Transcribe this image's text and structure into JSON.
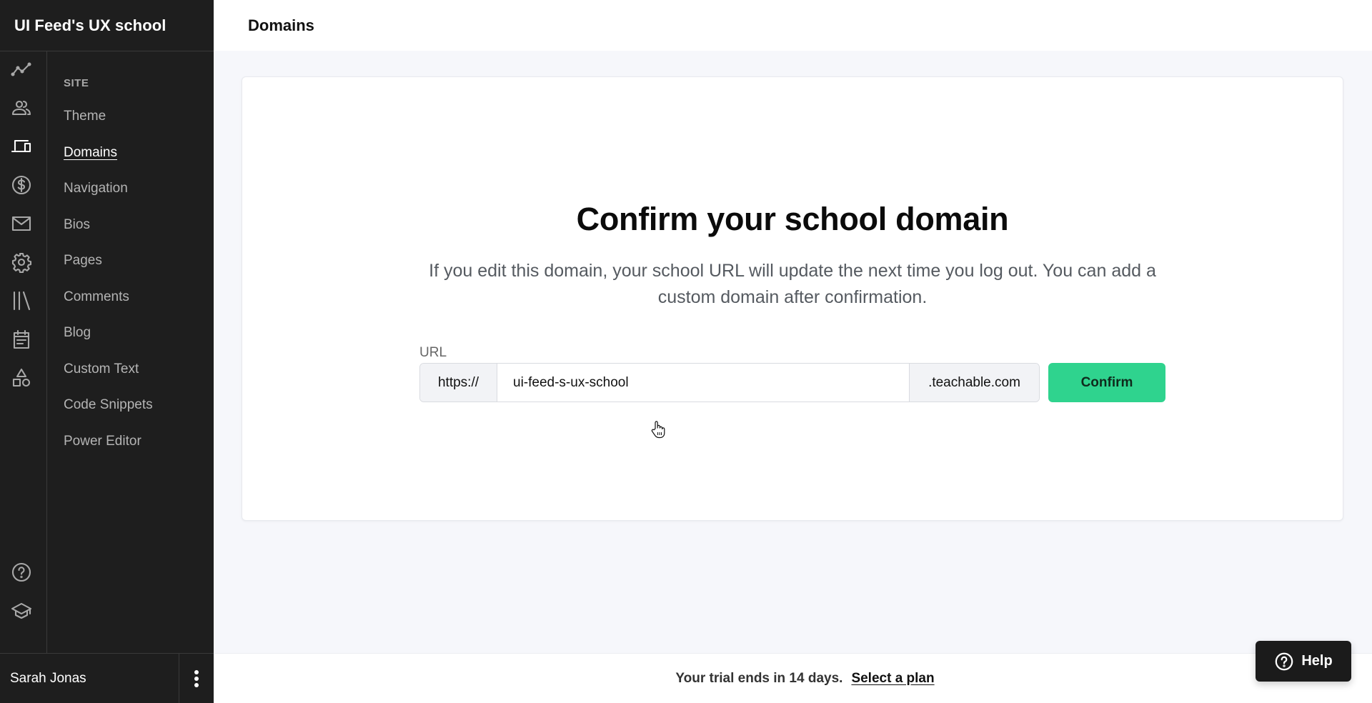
{
  "app": {
    "school_name": "UI Feed's UX school"
  },
  "rail": {
    "icons": [
      {
        "name": "analytics-icon",
        "label": "Analytics"
      },
      {
        "name": "users-icon",
        "label": "Users"
      },
      {
        "name": "site-icon",
        "label": "Site",
        "active": true
      },
      {
        "name": "sales-icon",
        "label": "Sales"
      },
      {
        "name": "emails-icon",
        "label": "Emails"
      },
      {
        "name": "settings-icon",
        "label": "Settings"
      },
      {
        "name": "courses-icon",
        "label": "Courses"
      },
      {
        "name": "calendar-icon",
        "label": "Calendar"
      },
      {
        "name": "apps-icon",
        "label": "Apps"
      }
    ],
    "bottom_icons": [
      {
        "name": "help-circle-icon",
        "label": "Help"
      },
      {
        "name": "school-cap-icon",
        "label": "Teachable U"
      }
    ]
  },
  "subnav": {
    "section": "SITE",
    "items": [
      {
        "label": "Theme"
      },
      {
        "label": "Domains",
        "active": true
      },
      {
        "label": "Navigation"
      },
      {
        "label": "Bios"
      },
      {
        "label": "Pages"
      },
      {
        "label": "Comments"
      },
      {
        "label": "Blog"
      },
      {
        "label": "Custom Text"
      },
      {
        "label": "Code Snippets"
      },
      {
        "label": "Power Editor"
      }
    ]
  },
  "user": {
    "name": "Sarah Jonas"
  },
  "header": {
    "title": "Domains"
  },
  "main": {
    "heading": "Confirm your school domain",
    "description": "If you edit this domain, your school URL will update the next time you log out. You can add a custom domain after confirmation.",
    "url_label": "URL",
    "url_prefix": "https://",
    "url_value": "ui-feed-s-ux-school",
    "url_suffix": ".teachable.com",
    "confirm_label": "Confirm"
  },
  "footer": {
    "trial_text": "Your trial ends in 14 days.",
    "plan_link": "Select a plan"
  },
  "help": {
    "label": "Help"
  },
  "colors": {
    "sidebar_bg": "#1e1e1e",
    "accent_green": "#2fd38e",
    "page_bg": "#f6f7fb"
  }
}
